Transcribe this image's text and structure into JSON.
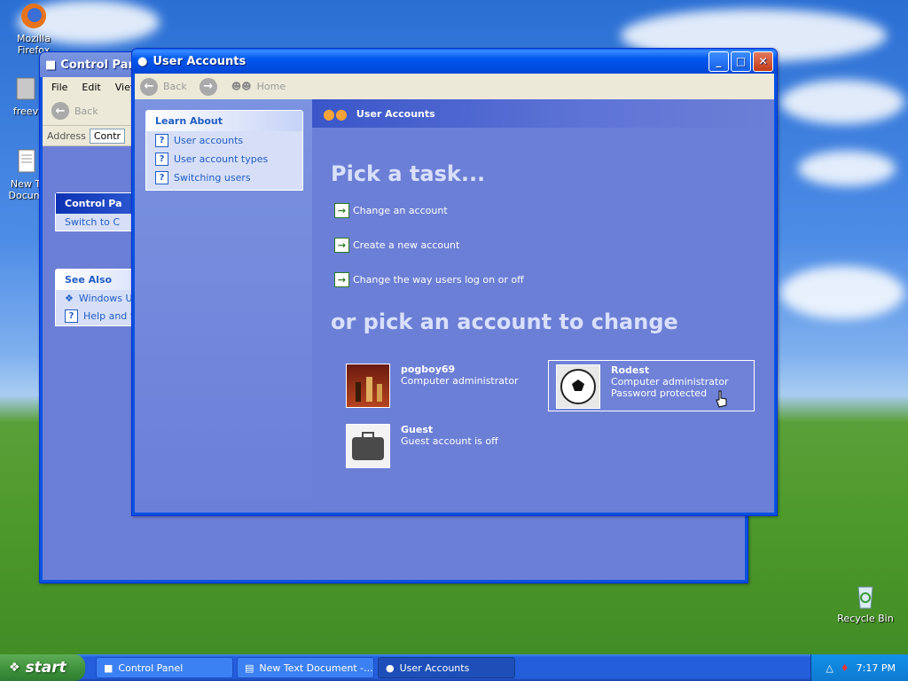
{
  "desktop": {
    "icons": [
      {
        "label": "Mozilla Firefox"
      },
      {
        "label": "freev"
      },
      {
        "label": "New T Docum"
      },
      {
        "label": "Recycle Bin"
      }
    ]
  },
  "control_panel": {
    "title": "Control Panel",
    "menu": [
      "File",
      "Edit",
      "View"
    ],
    "back_label": "Back",
    "address_label": "Address",
    "address_value": "Contr",
    "panel1": {
      "header": "Control Pa",
      "item": "Switch to C"
    },
    "see_also": {
      "header": "See Also",
      "items": [
        "Windows U",
        "Help and S"
      ]
    }
  },
  "user_accounts": {
    "title": "User Accounts",
    "toolbar": {
      "back": "Back",
      "home": "Home"
    },
    "learn_about": {
      "header": "Learn About",
      "items": [
        "User accounts",
        "User account types",
        "Switching users"
      ]
    },
    "header": "User Accounts",
    "pick_task": "Pick a task...",
    "tasks": [
      "Change an account",
      "Create a new account",
      "Change the way users log on or off"
    ],
    "pick_account": "or pick an account to change",
    "accounts": [
      {
        "name": "pogboy69",
        "lines": [
          "Computer administrator"
        ]
      },
      {
        "name": "Rodest",
        "lines": [
          "Computer administrator",
          "Password protected"
        ]
      },
      {
        "name": "Guest",
        "lines": [
          "Guest account is off"
        ]
      }
    ]
  },
  "taskbar": {
    "start": "start",
    "items": [
      "Control Panel",
      "New Text Document -...",
      "User Accounts"
    ],
    "clock": "7:17 PM"
  }
}
